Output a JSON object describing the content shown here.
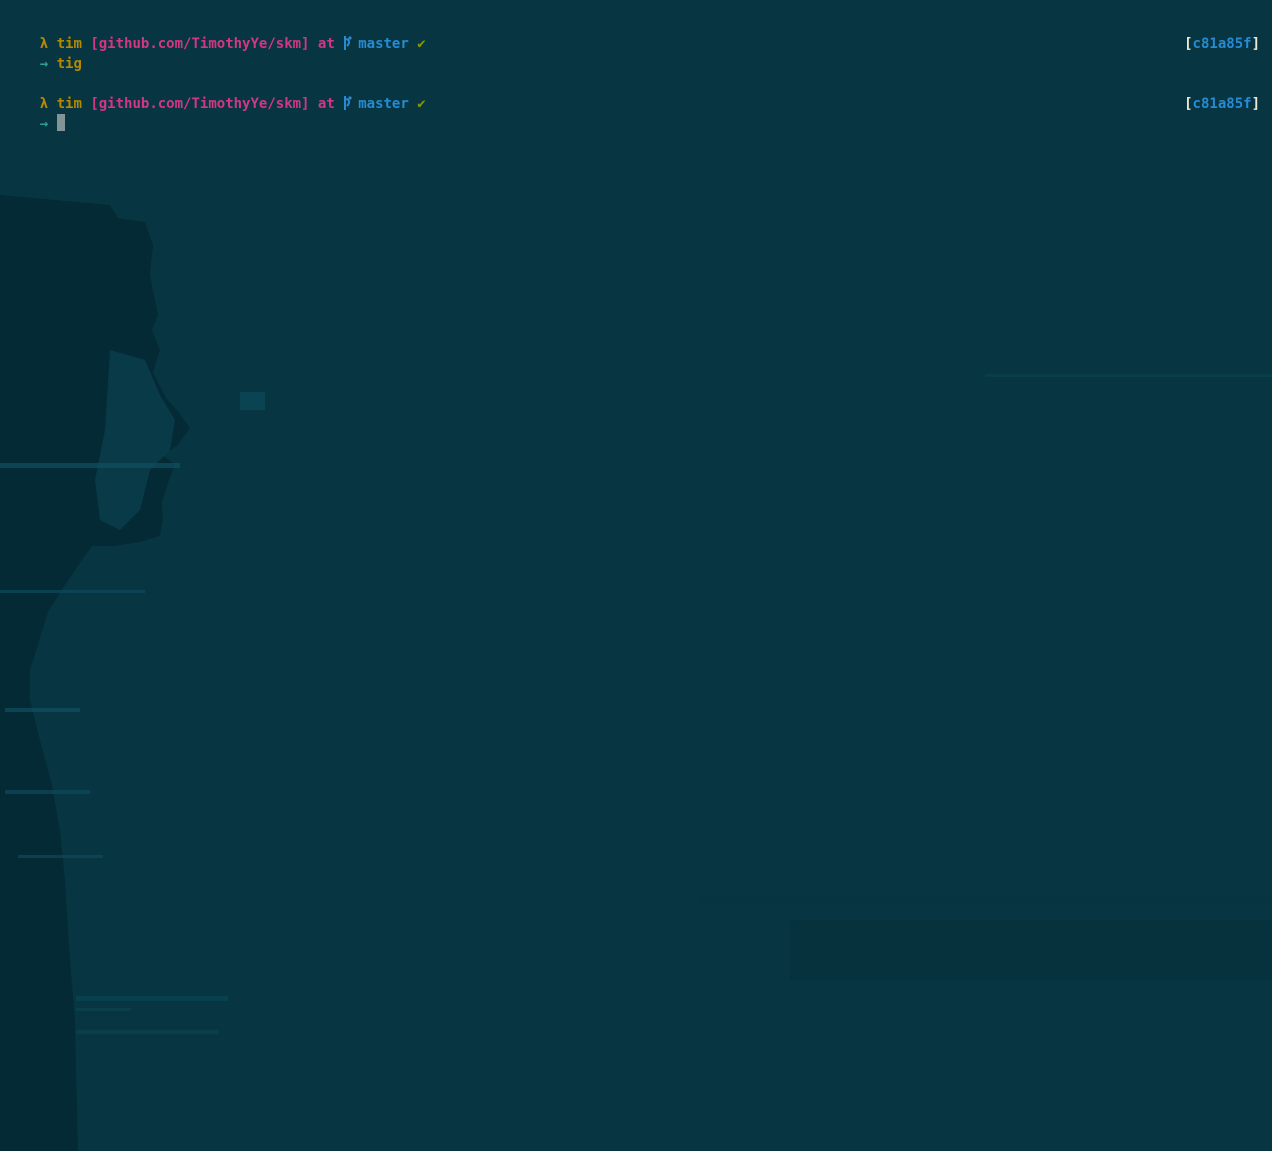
{
  "prompts": [
    {
      "lambda": "λ",
      "user": "tim",
      "repo": "[github.com/TimothyYe/skm]",
      "at": "at",
      "branch_icon": "git-branch-icon",
      "branch": "master",
      "clean_mark": "✔",
      "arrow": "→",
      "command": "tig",
      "hash_open": "[",
      "hash": "c81a85f",
      "hash_close": "]"
    },
    {
      "lambda": "λ",
      "user": "tim",
      "repo": "[github.com/TimothyYe/skm]",
      "at": "at",
      "branch_icon": "git-branch-icon",
      "branch": "master",
      "clean_mark": "✔",
      "arrow": "→",
      "command": "",
      "hash_open": "[",
      "hash": "c81a85f",
      "hash_close": "]"
    }
  ],
  "colors": {
    "background": "#073642",
    "user": "#b58900",
    "repo": "#d33682",
    "branch": "#268bd2",
    "clean": "#859900",
    "arrow": "#2aa198",
    "bracket": "#eee8d5",
    "cursor": "#839496"
  }
}
